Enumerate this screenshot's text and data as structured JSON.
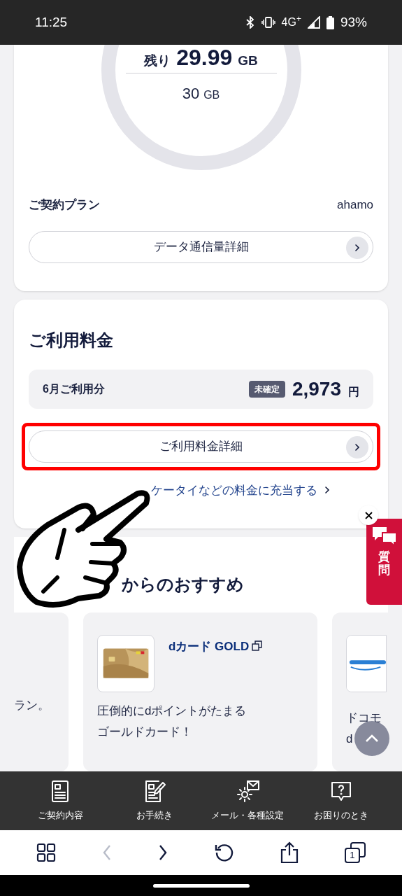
{
  "status_bar": {
    "time": "11:25",
    "network": "4G$^{+}$",
    "battery": "93%"
  },
  "data_usage": {
    "remaining_label": "残り",
    "remaining_value": "29.99",
    "remaining_unit": "GB",
    "total_value": "30",
    "total_unit": "GB"
  },
  "plan": {
    "label": "ご契約プラン",
    "value": "ahamo"
  },
  "data_detail_button": "データ通信量詳細",
  "billing": {
    "title": "ご利用料金",
    "month_label": "6月ご利用分",
    "status_badge": "未確定",
    "amount": "2,973",
    "currency": "円",
    "detail_button": "ご利用料金詳細",
    "highlighted": true,
    "link": "ケータイなどの料金に充当する"
  },
  "recommend": {
    "title": "からのおすすめ",
    "cards": [
      {
        "kind": "partial_left",
        "lines": [
          "ラン。"
        ]
      },
      {
        "kind": "full",
        "title": "dカード GOLD",
        "external": true,
        "lines": [
          "圧倒的にdポイントがたまる",
          "ゴールドカード！"
        ]
      },
      {
        "kind": "partial_right",
        "lines": [
          "ドコモ",
          "d"
        ]
      }
    ]
  },
  "chat_tab": {
    "label": "質問"
  },
  "bottom_nav": [
    {
      "label": "ご契約内容"
    },
    {
      "label": "お手続き"
    },
    {
      "label": "メール・各種設定"
    },
    {
      "label": "お困りのとき"
    }
  ],
  "browser_toolbar": {
    "back_disabled": true,
    "tab_count": "1"
  }
}
